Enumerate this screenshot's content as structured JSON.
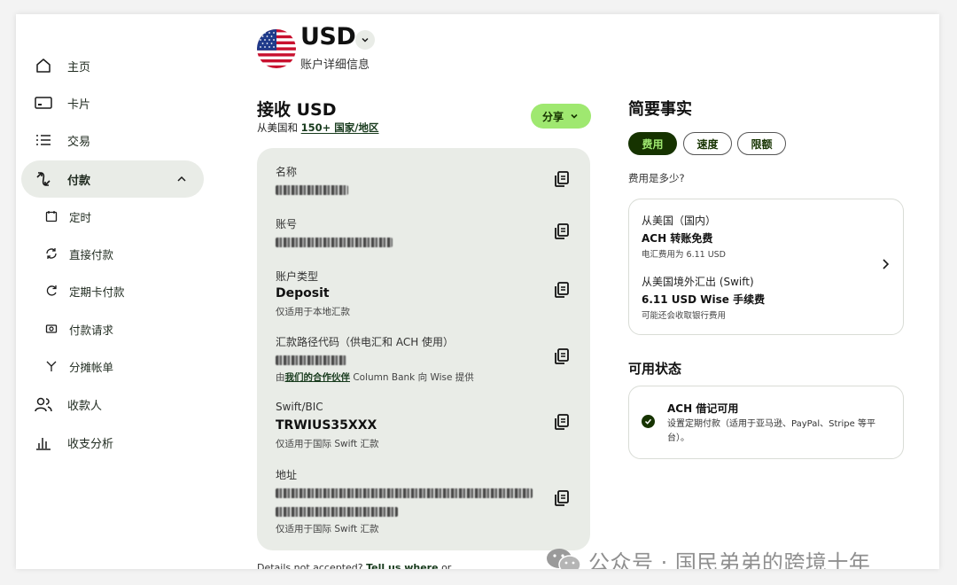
{
  "sidebar": {
    "items": [
      {
        "label": "主页",
        "icon": "home-icon"
      },
      {
        "label": "卡片",
        "icon": "card-icon"
      },
      {
        "label": "交易",
        "icon": "list-icon"
      },
      {
        "label": "付款",
        "icon": "payments-icon",
        "expanded": true
      },
      {
        "label": "收款人",
        "icon": "recipients-icon"
      },
      {
        "label": "收支分析",
        "icon": "insights-icon"
      }
    ],
    "sub_items": [
      {
        "label": "定时",
        "icon": "calendar-icon"
      },
      {
        "label": "直接付款",
        "icon": "refresh-icon"
      },
      {
        "label": "定期卡付款",
        "icon": "recurring-icon"
      },
      {
        "label": "付款请求",
        "icon": "request-icon"
      },
      {
        "label": "分摊帐单",
        "icon": "split-icon"
      }
    ]
  },
  "header": {
    "currency": "USD",
    "subtitle": "账户详细信息",
    "flag_icon": "us-flag-icon"
  },
  "receive": {
    "title": "接收 USD",
    "subtitle_prefix": "从美国和",
    "subtitle_link": "150+ 国家/地区",
    "share_label": "分享"
  },
  "details": {
    "name_label": "名称",
    "account_number_label": "账号",
    "account_type_label": "账户类型",
    "account_type_value": "Deposit",
    "account_type_note": "仅适用于本地汇款",
    "routing_label": "汇款路径代码（供电汇和 ACH 使用）",
    "routing_note_prefix": "由",
    "routing_note_link": "我们的合作伙伴",
    "routing_note_suffix": "Column Bank 向 Wise 提供",
    "swift_label": "Swift/BIC",
    "swift_value": "TRWIUS35XXX",
    "swift_note": "仅适用于国际 Swift 汇款",
    "address_label": "地址",
    "address_note": "仅适用于国际 Swift 汇款"
  },
  "bottom": {
    "prefix": "Details not accepted?",
    "link": "Tell us where",
    "suffix": "or"
  },
  "facts": {
    "title": "简要事实",
    "tabs": [
      "费用",
      "速度",
      "限额"
    ],
    "active_tab": "费用",
    "question": "费用是多少?",
    "domestic_label": "从美国（国内）",
    "domestic_value": "ACH 转账免费",
    "domestic_note": "电汇费用为 6.11 USD",
    "intl_label": "从美国境外汇出 (Swift)",
    "intl_value": "6.11 USD Wise 手续费",
    "intl_note": "可能还会收取银行费用"
  },
  "availability": {
    "title": "可用状态",
    "head": "ACH 借记可用",
    "text": "设置定期付款（适用于亚马逊、PayPal、Stripe 等平台）。"
  },
  "watermark": {
    "text": "公众号 · 国民弟弟的跨境十年"
  },
  "colors": {
    "accent_green": "#9fe870",
    "dark_green": "#163300",
    "panel_bg": "#e9ece7"
  }
}
